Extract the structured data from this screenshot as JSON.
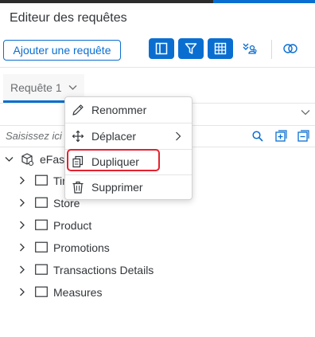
{
  "header": {
    "title": "Editeur des requêtes",
    "add_query_label": "Ajouter une requête"
  },
  "toolbar": {
    "icons": [
      "panel-layout-icon",
      "filter-icon",
      "grid-icon",
      "hierarchy-users-icon",
      "link-rings-icon"
    ]
  },
  "tabs": [
    {
      "label": "Requête 1"
    }
  ],
  "search": {
    "placeholder": "Saisissez ici"
  },
  "tree": {
    "root_label": "eFas",
    "items": [
      {
        "label": "Tir"
      },
      {
        "label": "Store"
      },
      {
        "label": "Product"
      },
      {
        "label": "Promotions"
      },
      {
        "label": "Transactions Details"
      },
      {
        "label": "Measures"
      }
    ]
  },
  "context_menu": {
    "items": [
      {
        "label": "Renommer",
        "icon": "pencil-icon"
      },
      {
        "label": "Déplacer",
        "icon": "move-icon",
        "has_submenu": true
      },
      {
        "label": "Dupliquer",
        "icon": "copy-icon",
        "highlighted": true
      },
      {
        "label": "Supprimer",
        "icon": "trash-icon"
      }
    ]
  },
  "colors": {
    "accent": "#0a6ed1",
    "highlight": "#e5212e",
    "text": "#32363a"
  }
}
